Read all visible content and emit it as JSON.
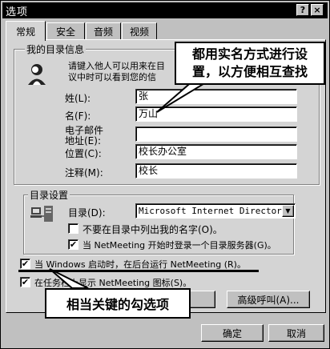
{
  "window": {
    "title": "选项",
    "help_btn": "?",
    "close_btn": "×"
  },
  "tabs": [
    "常规",
    "安全",
    "音频",
    "视频"
  ],
  "my_info": {
    "group_label": "我的目录信息",
    "intro": "请键入他人可以用来在目录...议中时可以看到您的信息。",
    "intro_line1": "请键入他人可以用来在目",
    "intro_line2": "议中时可以看到您的信",
    "fields": [
      {
        "label": "姓(L):",
        "value": "张"
      },
      {
        "label": "名(F):",
        "value": "万山"
      },
      {
        "label": "电子邮件",
        "label2": "地址(E):",
        "value": ""
      },
      {
        "label": "位置(C):",
        "value": "校长办公室"
      },
      {
        "label": "注释(M):",
        "value": "校长"
      }
    ]
  },
  "directory": {
    "group_label": "目录设置",
    "dir_label": "目录(D):",
    "dir_value": "Microsoft Internet Directory",
    "dropdown_arrow": "▼",
    "cb_hide": {
      "label": "不要在目录中列出我的名字(O)。",
      "checked": false
    },
    "cb_login": {
      "label": "当 NetMeeting 开始时登录一个目录服务器(G)。",
      "checked": true
    }
  },
  "startup": {
    "cb_run": {
      "label": "当 Windows 启动时，在后台运行 NetMeeting (R)。",
      "checked": true
    },
    "cb_tray": {
      "label": "在任务栏上显示 NetMeeting 图标(S)。",
      "checked": true
    },
    "advanced_btn": "高级呼叫(A)..."
  },
  "footer": {
    "ok": "确定",
    "cancel": "取消"
  },
  "annotations": {
    "callout_top_line1": "都用实名方式进行设",
    "callout_top_line2": "置，以方便相互查找",
    "callout_bottom": "相当关键的勾选项"
  },
  "check_glyph": "✔"
}
